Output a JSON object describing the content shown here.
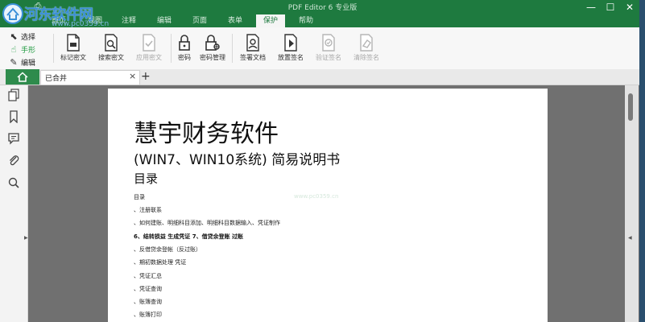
{
  "app": {
    "title": "PDF Editor 6 专业版",
    "watermark": {
      "name": "河东软件网",
      "url": "www.pc0359.cn"
    }
  },
  "window_controls": {
    "minimize": "—",
    "maximize": "☐",
    "close": "✕"
  },
  "menu": {
    "tabs": [
      "首页",
      "视图",
      "注释",
      "编辑",
      "页面",
      "表单",
      "保护",
      "帮助"
    ],
    "active": "保护"
  },
  "tools": [
    {
      "label": "选择",
      "icon": "cursor-icon",
      "selected": false
    },
    {
      "label": "手形",
      "icon": "hand-icon",
      "selected": true
    },
    {
      "label": "编辑",
      "icon": "edit-icon",
      "selected": false
    }
  ],
  "ribbon": {
    "buttons": [
      {
        "label": "标记密文",
        "icon": "mark-redaction-icon",
        "enabled": true
      },
      {
        "label": "搜索密文",
        "icon": "search-redaction-icon",
        "enabled": true
      },
      {
        "label": "应用密文",
        "icon": "apply-redaction-icon",
        "enabled": false
      },
      {
        "label": "密码",
        "icon": "lock-icon",
        "enabled": true
      },
      {
        "label": "密码管理",
        "icon": "password-manager-icon",
        "enabled": true
      },
      {
        "label": "签署文档",
        "icon": "sign-document-icon",
        "enabled": true
      },
      {
        "label": "放置签名",
        "icon": "place-signature-icon",
        "enabled": true
      },
      {
        "label": "验证签名",
        "icon": "verify-signature-icon",
        "enabled": false
      },
      {
        "label": "清除签名",
        "icon": "clear-signature-icon",
        "enabled": false
      }
    ]
  },
  "doc_tabs": {
    "home_icon": "home-icon",
    "items": [
      {
        "label": "已合并",
        "close": "×"
      }
    ],
    "new_tab": "+"
  },
  "sidebar": {
    "icons": [
      "pages-icon",
      "bookmark-icon",
      "comment-icon",
      "attachment-icon",
      "search-icon"
    ]
  },
  "document": {
    "title": "慧宇财务软件",
    "subtitle": "(WIN7、WIN10系统) 简易说明书",
    "toc_heading": "目录",
    "page_watermark": "www.pc0359.cn",
    "toc": [
      "目录",
      "、注册联系",
      "、如何建账、明细科目添加、明细科目数据输入、凭证制作",
      "6、结转损益 生成凭证 7、借贷余登账 过账",
      "、反借贷余登帐（反过账）",
      "、期初数据处理 凭证",
      "、凭证汇总",
      "、凭证查询",
      "、账簿查询",
      "、账簿打印"
    ]
  },
  "colors": {
    "accent": "#1e7a3f",
    "active_tool": "#1e9a3f",
    "canvas": "#707070"
  }
}
